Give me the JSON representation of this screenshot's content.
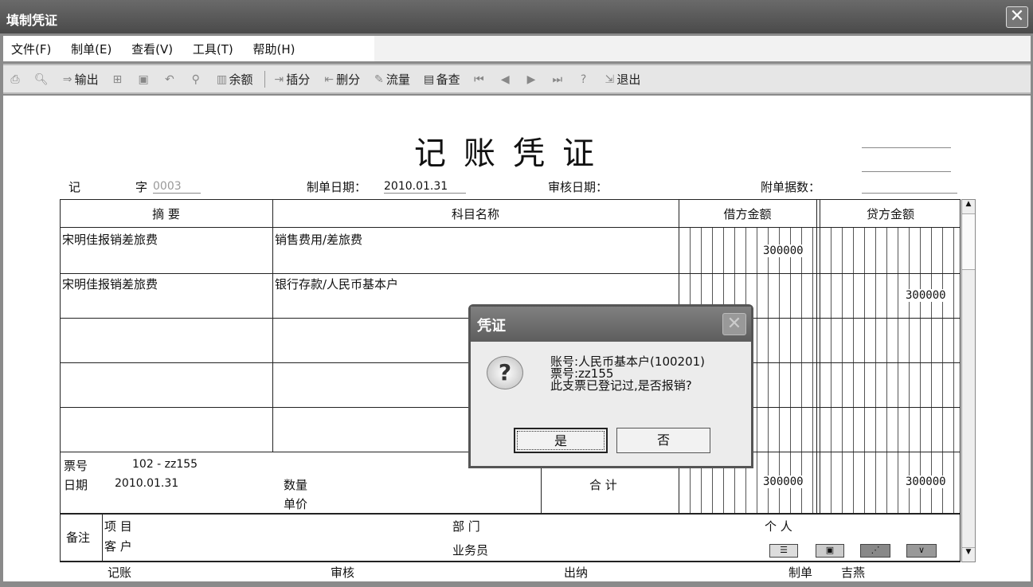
{
  "window": {
    "title": "填制凭证",
    "close": "✕"
  },
  "menu": [
    "文件(F)",
    "制单(E)",
    "查看(V)",
    "工具(T)",
    "帮助(H)"
  ],
  "toolbar": {
    "output": "输出",
    "balance": "余额",
    "insert": "插分",
    "delete": "删分",
    "flow": "流量",
    "check": "备查",
    "exit": "退出"
  },
  "voucher": {
    "title": "记账凭证",
    "type": "记",
    "zi": "字",
    "number": "0003",
    "date_label": "制单日期：",
    "date": "2010.01.31",
    "audit_label": "审核日期：",
    "attach_label": "附单据数：",
    "headers": [
      "摘 要",
      "科目名称",
      "借方金额",
      "贷方金额"
    ],
    "rows": [
      {
        "summary": "宋明佳报销差旅费",
        "account": "销售费用/差旅费",
        "debit": "300000",
        "credit": ""
      },
      {
        "summary": "宋明佳报销差旅费",
        "account": "银行存款/人民币基本户",
        "debit": "",
        "credit": "300000"
      }
    ],
    "ticket_label": "票号",
    "ticket": "102 - zz155",
    "tdate_label": "日期",
    "tdate": "2010.01.31",
    "qty_label": "数量",
    "price_label": "单价",
    "total_label": "合 计",
    "total_debit": "300000",
    "total_credit": "300000",
    "remark_label": "备注",
    "project_label": "项 目",
    "customer_label": "客 户",
    "dept_label": "部 门",
    "clerk_label": "业务员",
    "person_label": "个 人",
    "sign": {
      "book": "记账",
      "audit": "审核",
      "cashier": "出纳",
      "maker_label": "制单",
      "maker": "吉燕"
    }
  },
  "dialog": {
    "title": "凭证",
    "line1": "账号:人民币基本户(100201)",
    "line2": "票号:zz155",
    "line3": "此支票已登记过,是否报销?",
    "yes": "是",
    "no": "否"
  }
}
